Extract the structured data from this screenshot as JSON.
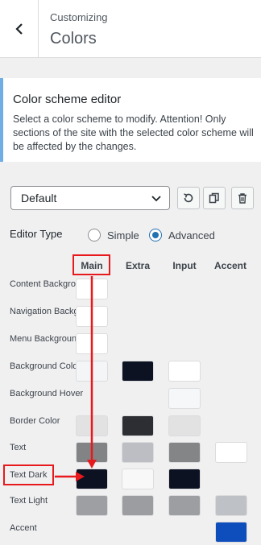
{
  "header": {
    "breadcrumb": "Customizing",
    "title": "Colors"
  },
  "notice": {
    "title": "Color scheme editor",
    "text": "Select a color scheme to modify. Attention! Only sections of the site with the selected color scheme will be affected by the changes."
  },
  "scheme_select": {
    "value": "Default"
  },
  "editor_type": {
    "label": "Editor Type",
    "options": [
      "Simple",
      "Advanced"
    ],
    "selected": "Advanced"
  },
  "columns": [
    "Main",
    "Extra",
    "Input",
    "Accent"
  ],
  "rows": [
    {
      "label": "Content Background",
      "colors": [
        "#ffffff",
        null,
        null,
        null
      ]
    },
    {
      "label": "Navigation Background",
      "colors": [
        "#ffffff",
        null,
        null,
        null
      ]
    },
    {
      "label": "Menu Background",
      "colors": [
        "#ffffff",
        null,
        null,
        null
      ]
    },
    {
      "label": "Background Color",
      "colors": [
        "#f4f5f6",
        "#0c1222",
        "#ffffff",
        null
      ]
    },
    {
      "label": "Background Hover",
      "colors": [
        null,
        null,
        "#f6f7f8",
        null
      ]
    },
    {
      "label": "Border Color",
      "colors": [
        "#e2e2e3",
        "#2c2e33",
        "#e2e2e3",
        null
      ]
    },
    {
      "label": "Text",
      "colors": [
        "#828385",
        "#bcbec3",
        "#838587",
        "#ffffff"
      ]
    },
    {
      "label": "Text Dark",
      "colors": [
        "#0c1222",
        "#f8f8f8",
        "#0c1222",
        null
      ]
    },
    {
      "label": "Text Light",
      "colors": [
        "#9d9fa2",
        "#9b9da0",
        "#9c9ea1",
        "#bec1c6"
      ]
    },
    {
      "label": "Accent",
      "colors": [
        null,
        null,
        null,
        "#0e4dbc"
      ]
    }
  ],
  "accent_colors": {
    "highlight": "#e8191c",
    "wp_blue": "#2271b1"
  }
}
